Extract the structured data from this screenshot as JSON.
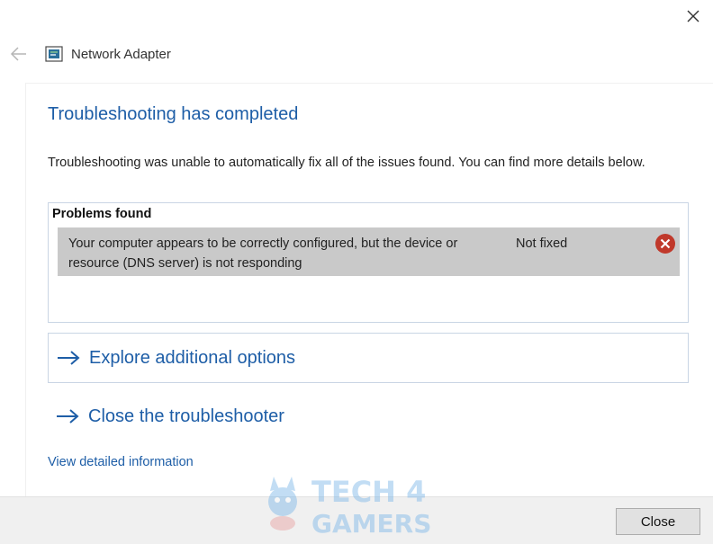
{
  "window": {
    "title": "Network Adapter"
  },
  "icons": {
    "close": "close-icon",
    "back": "back-arrow-icon",
    "network": "network-adapter-icon",
    "error": "error-circle-icon",
    "option_arrow": "arrow-right-icon"
  },
  "main": {
    "heading": "Troubleshooting has completed",
    "description": "Troubleshooting was unable to automatically fix all of the issues found. You can find more details below.",
    "problems": {
      "header": "Problems found",
      "items": [
        {
          "text": "Your computer appears to be correctly configured, but the device or resource (DNS server) is not responding",
          "status": "Not fixed"
        }
      ]
    },
    "options": [
      {
        "label": "Explore additional options"
      },
      {
        "label": "Close the troubleshooter"
      }
    ],
    "detail_link": "View detailed information"
  },
  "footer": {
    "close_label": "Close"
  },
  "watermark": {
    "text_line1": "TECH 4",
    "text_line2": "GAMERS"
  },
  "colors": {
    "accent": "#1e5ea7",
    "error": "#c0392b",
    "problem_row": "#c9c9c9",
    "footer": "#f0f0f0"
  }
}
